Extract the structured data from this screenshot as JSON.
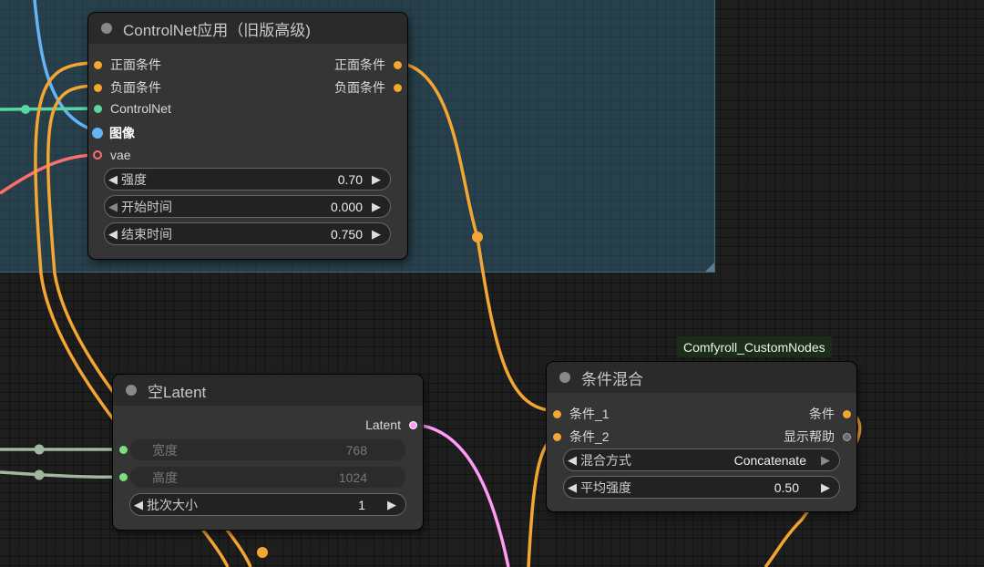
{
  "colors": {
    "conditioning": "#f4a632",
    "controlnet": "#58d8a0",
    "image": "#64b5f6",
    "vae": "#ff6e6e",
    "latent": "#ff9cf9",
    "int": "#a0b8a0",
    "help": "#888888"
  },
  "controlnet_node": {
    "title": "ControlNet应用（旧版高级)",
    "inputs": [
      "正面条件",
      "负面条件",
      "ControlNet",
      "图像",
      "vae"
    ],
    "outputs": [
      "正面条件",
      "负面条件"
    ],
    "widgets": [
      {
        "label": "强度",
        "value": "0.70"
      },
      {
        "label": "开始时间",
        "value": "0.000"
      },
      {
        "label": "结束时间",
        "value": "0.750"
      }
    ]
  },
  "latent_node": {
    "title": "空Latent",
    "output": "Latent",
    "widgets": [
      {
        "label": "宽度",
        "value": "768"
      },
      {
        "label": "高度",
        "value": "1024"
      },
      {
        "label": "批次大小",
        "value": "1"
      }
    ]
  },
  "combine_node": {
    "badge": "Comfyroll_CustomNodes",
    "title": "条件混合",
    "inputs": [
      "条件_1",
      "条件_2"
    ],
    "outputs": [
      "条件",
      "显示帮助"
    ],
    "widgets": [
      {
        "label": "混合方式",
        "value": "Concatenate"
      },
      {
        "label": "平均强度",
        "value": "0.50"
      }
    ]
  }
}
